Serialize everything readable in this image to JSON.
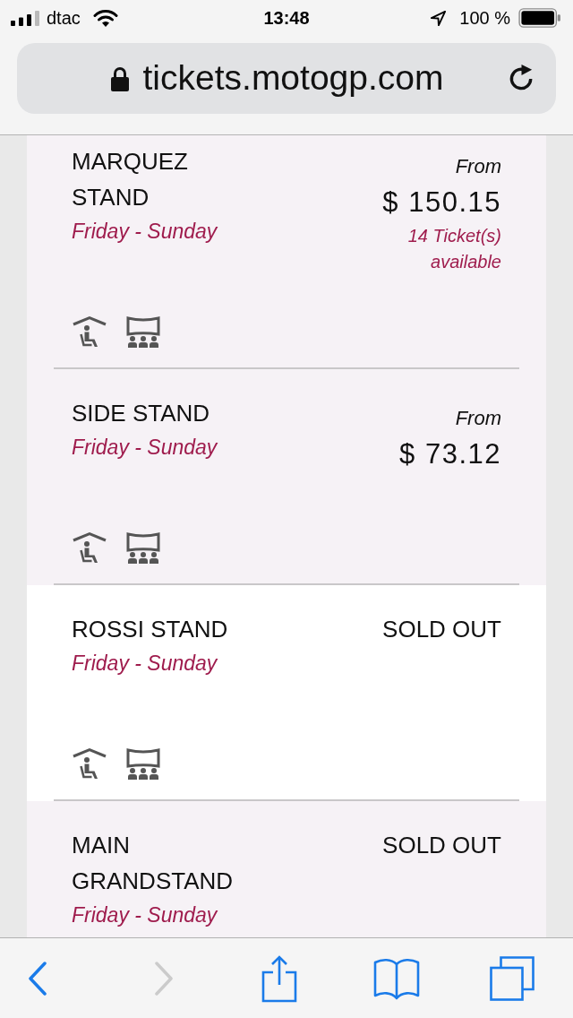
{
  "status_bar": {
    "carrier": "dtac",
    "time": "13:48",
    "battery": "100 %"
  },
  "address_bar": {
    "url": "tickets.motogp.com"
  },
  "stands": [
    {
      "name": "MARQUEZ STAND",
      "days": "Friday - Sunday",
      "kind": "available",
      "price_label": "From",
      "price": "$ 150.15",
      "availability": "14 Ticket(s) available",
      "shaded": true,
      "amenities": [
        {
          "kind": "covered"
        },
        {
          "kind": "screen"
        }
      ]
    },
    {
      "name": "SIDE STAND",
      "days": "Friday - Sunday",
      "kind": "available",
      "price_label": "From",
      "price": "$ 73.12",
      "shaded": true,
      "amenities": [
        {
          "kind": "covered"
        },
        {
          "kind": "screen"
        }
      ]
    },
    {
      "name": "ROSSI STAND",
      "days": "Friday - Sunday",
      "kind": "sold_out",
      "status": "SOLD OUT",
      "shaded": false,
      "amenities": [
        {
          "kind": "covered"
        },
        {
          "kind": "screen"
        }
      ]
    },
    {
      "name": "MAIN GRANDSTAND",
      "days": "Friday - Sunday",
      "kind": "sold_out",
      "status": "SOLD OUT",
      "shaded": true
    }
  ],
  "toolbar": [
    {
      "kind": "back",
      "disabled": false
    },
    {
      "kind": "forward",
      "disabled": true
    },
    {
      "kind": "share",
      "disabled": false
    },
    {
      "kind": "bookmarks",
      "disabled": false
    },
    {
      "kind": "tabs",
      "disabled": false
    }
  ]
}
